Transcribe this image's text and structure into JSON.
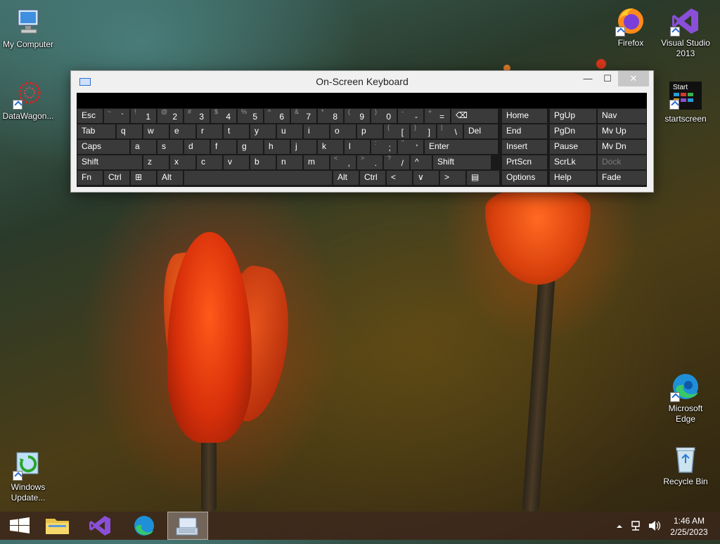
{
  "desktop": {
    "icons_left": [
      {
        "id": "my-computer",
        "label": "My Computer"
      },
      {
        "id": "datawagon",
        "label": "DataWagon..."
      },
      {
        "id": "windows-update",
        "label": "Windows Update..."
      }
    ],
    "icons_right": [
      {
        "id": "firefox",
        "label": "Firefox"
      },
      {
        "id": "visual-studio",
        "label": "Visual Studio 2013"
      },
      {
        "id": "startscreen",
        "label": "startscreen",
        "tile_text": "Start"
      },
      {
        "id": "edge",
        "label": "Microsoft Edge"
      },
      {
        "id": "recycle-bin",
        "label": "Recycle Bin"
      }
    ]
  },
  "osk": {
    "title": "On-Screen Keyboard",
    "controls": {
      "minimize": "—",
      "maximize": "☐",
      "close": "✕"
    },
    "rows": [
      [
        {
          "main": "Esc"
        },
        {
          "sub": "~",
          "main": "`"
        },
        {
          "sub": "!",
          "main": "1"
        },
        {
          "sub": "@",
          "main": "2"
        },
        {
          "sub": "#",
          "main": "3"
        },
        {
          "sub": "$",
          "main": "4"
        },
        {
          "sub": "%",
          "main": "5"
        },
        {
          "sub": "^",
          "main": "6"
        },
        {
          "sub": "&",
          "main": "7"
        },
        {
          "sub": "*",
          "main": "8"
        },
        {
          "sub": "(",
          "main": "9"
        },
        {
          "sub": ")",
          "main": "0"
        },
        {
          "sub": "-",
          "main": "-"
        },
        {
          "sub": "+",
          "main": "="
        },
        {
          "main": "⌫"
        }
      ],
      [
        {
          "main": "Tab"
        },
        {
          "main": "q"
        },
        {
          "main": "w"
        },
        {
          "main": "e"
        },
        {
          "main": "r"
        },
        {
          "main": "t"
        },
        {
          "main": "y"
        },
        {
          "main": "u"
        },
        {
          "main": "i"
        },
        {
          "main": "o"
        },
        {
          "main": "p"
        },
        {
          "sub": "{",
          "main": "["
        },
        {
          "sub": "}",
          "main": "]"
        },
        {
          "sub": "|",
          "main": "\\"
        },
        {
          "main": "Del"
        }
      ],
      [
        {
          "main": "Caps"
        },
        {
          "main": "a"
        },
        {
          "main": "s"
        },
        {
          "main": "d"
        },
        {
          "main": "f"
        },
        {
          "main": "g"
        },
        {
          "main": "h"
        },
        {
          "main": "j"
        },
        {
          "main": "k"
        },
        {
          "main": "l"
        },
        {
          "sub": ":",
          "main": ";"
        },
        {
          "sub": "\"",
          "main": "'"
        },
        {
          "main": "Enter"
        }
      ],
      [
        {
          "main": "Shift"
        },
        {
          "main": "z"
        },
        {
          "main": "x"
        },
        {
          "main": "c"
        },
        {
          "main": "v"
        },
        {
          "main": "b"
        },
        {
          "main": "n"
        },
        {
          "main": "m"
        },
        {
          "sub": "<",
          "main": ","
        },
        {
          "sub": ">",
          "main": "."
        },
        {
          "sub": "?",
          "main": "/"
        },
        {
          "main": "^"
        },
        {
          "main": "Shift"
        }
      ],
      [
        {
          "main": "Fn"
        },
        {
          "main": "Ctrl"
        },
        {
          "main": "⊞"
        },
        {
          "main": "Alt"
        },
        {
          "main": ""
        },
        {
          "main": "Alt"
        },
        {
          "main": "Ctrl"
        },
        {
          "main": "<"
        },
        {
          "main": "∨"
        },
        {
          "main": ">"
        },
        {
          "main": "▤"
        }
      ]
    ],
    "nav_rows": [
      [
        "Home",
        "PgUp",
        "Nav"
      ],
      [
        "End",
        "PgDn",
        "Mv Up"
      ],
      [
        "Insert",
        "Pause",
        "Mv Dn"
      ],
      [
        "PrtScn",
        "ScrLk",
        "Dock"
      ],
      [
        "Options",
        "Help",
        "Fade"
      ]
    ]
  },
  "taskbar": {
    "clock_time": "1:46 AM",
    "clock_date": "2/25/2023"
  },
  "colors": {
    "key_bg": "#3a3a3a",
    "keyboard_bg": "#1a1a1a",
    "taskbar_bg": "#3c281e"
  }
}
